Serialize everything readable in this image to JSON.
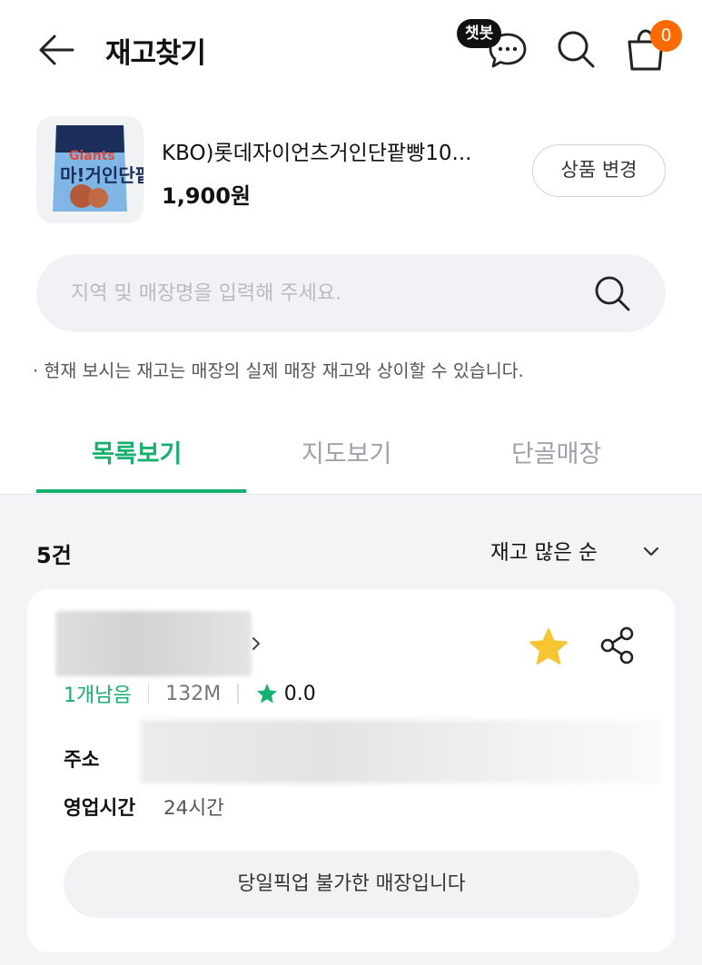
{
  "header": {
    "title": "재고찾기",
    "chat_badge": "챗봇",
    "cart_count": "0"
  },
  "product": {
    "name": "KBO)롯데자이언츠거인단팥빵10...",
    "price": "1,900원",
    "change_label": "상품 변경",
    "thumb_text": "마!거인단팥빵"
  },
  "search": {
    "placeholder": "지역 및 매장명을 입력해 주세요."
  },
  "notice": "· 현재 보시는 재고는 매장의 실제 매장 재고와 상이할 수 있습니다.",
  "tabs": [
    {
      "label": "목록보기",
      "active": true
    },
    {
      "label": "지도보기",
      "active": false
    },
    {
      "label": "단골매장",
      "active": false
    }
  ],
  "list": {
    "count": "5건",
    "sort_label": "재고 많은 순"
  },
  "store": {
    "remaining": "1개남음",
    "distance": "132M",
    "rating": "0.0",
    "address_label": "주소",
    "hours_label": "영업시간",
    "hours_value": "24시간",
    "pickup_label": "당일픽업 불가한 매장입니다"
  },
  "colors": {
    "accent": "#14b26e",
    "badge": "#ff6a00",
    "favorite_star": "#f7c531"
  },
  "icons": [
    "back-arrow-icon",
    "chat-icon",
    "search-icon",
    "cart-icon",
    "chevron-down-icon",
    "chevron-right-icon",
    "star-icon",
    "share-icon"
  ]
}
